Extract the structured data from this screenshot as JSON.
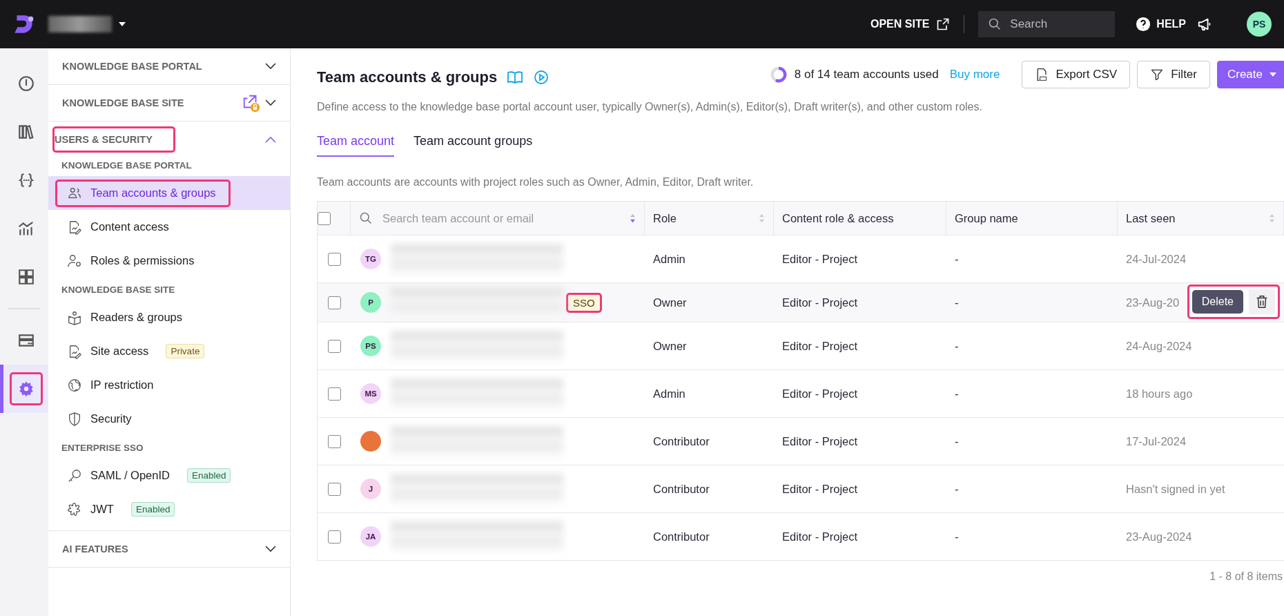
{
  "topbar": {
    "open_site": "OPEN SITE",
    "search": {
      "placeholder": "Search"
    },
    "help": "HELP",
    "user_initials": "PS"
  },
  "rail": [
    {
      "selected": false,
      "highlighted": false
    },
    {
      "selected": false,
      "highlighted": false
    },
    {
      "selected": false,
      "highlighted": false
    },
    {
      "selected": false,
      "highlighted": false
    },
    {
      "selected": false,
      "highlighted": false
    },
    {
      "selected": false,
      "highlighted": false
    },
    {
      "selected": true,
      "highlighted": true
    }
  ],
  "sidebar": [
    {
      "title": "KNOWLEDGE BASE PORTAL",
      "expanded": false,
      "highlighted": false,
      "locked": false
    },
    {
      "title": "KNOWLEDGE BASE SITE",
      "expanded": false,
      "highlighted": false,
      "locked": true
    },
    {
      "title": "USERS & SECURITY",
      "expanded": true,
      "highlighted": true,
      "locked": false,
      "groups": [
        {
          "title": "KNOWLEDGE BASE PORTAL",
          "items": [
            {
              "label": "Team accounts & groups",
              "selected": true,
              "highlighted": true
            },
            {
              "label": "Content access",
              "selected": false,
              "highlighted": false
            },
            {
              "label": "Roles & permissions",
              "selected": false,
              "highlighted": false
            }
          ]
        },
        {
          "title": "KNOWLEDGE BASE SITE",
          "items": [
            {
              "label": "Readers & groups",
              "selected": false,
              "highlighted": false
            },
            {
              "label": "Site access",
              "selected": false,
              "highlighted": false,
              "badge": {
                "text": "Private",
                "kind": "warning"
              }
            },
            {
              "label": "IP restriction",
              "selected": false,
              "highlighted": false
            },
            {
              "label": "Security",
              "selected": false,
              "highlighted": false
            }
          ]
        },
        {
          "title": "ENTERPRISE SSO",
          "items": [
            {
              "label": "SAML / OpenID",
              "selected": false,
              "highlighted": false,
              "badge": {
                "text": "Enabled",
                "kind": "success"
              }
            },
            {
              "label": "JWT",
              "selected": false,
              "highlighted": false,
              "badge": {
                "text": "Enabled",
                "kind": "success"
              }
            }
          ]
        }
      ]
    },
    {
      "title": "AI FEATURES",
      "expanded": false,
      "highlighted": false,
      "locked": false
    }
  ],
  "page": {
    "title": "Team accounts & groups",
    "description": "Define access to the knowledge base portal account user, typically Owner(s), Admin(s), Editor(s), Draft writer(s), and other custom roles.",
    "usage": {
      "text": "8 of 14 team accounts used",
      "level": 0.57
    },
    "buy_more": "Buy more",
    "buttons": [
      {
        "label": "Export CSV",
        "kind": "csv"
      },
      {
        "label": "Filter",
        "kind": "filter"
      },
      {
        "label": "Create",
        "kind": "primary"
      }
    ],
    "tabs": [
      {
        "label": "Team account",
        "selected": true
      },
      {
        "label": "Team account groups",
        "selected": false
      }
    ],
    "note": "Team accounts are accounts with project roles such as Owner, Admin, Editor, Draft writer."
  },
  "table": {
    "select_all_checked": false,
    "search_placeholder": "Search team account or email",
    "columns": [
      {
        "label": "Role",
        "sortable": true
      },
      {
        "label": "Content role & access",
        "sortable": false
      },
      {
        "label": "Group name",
        "sortable": false
      },
      {
        "label": "Last seen",
        "sortable": true
      }
    ],
    "delete_tooltip": "Delete",
    "rows": [
      {
        "checked": false,
        "hovered": false,
        "avatar": {
          "kind": "initials",
          "text": "TG",
          "color": "#f2d4f8"
        },
        "role": "Admin",
        "content": "Editor - Project",
        "group": "-",
        "last_seen": "24-Jul-2024"
      },
      {
        "checked": false,
        "hovered": true,
        "avatar": {
          "kind": "initials",
          "text": "P",
          "color": "#8ff0c2"
        },
        "badge": "SSO",
        "role": "Owner",
        "content": "Editor - Project",
        "group": "-",
        "last_seen": "23-Aug-20"
      },
      {
        "checked": false,
        "hovered": false,
        "avatar": {
          "kind": "initials",
          "text": "PS",
          "color": "#8ff0c2"
        },
        "role": "Owner",
        "content": "Editor - Project",
        "group": "-",
        "last_seen": "24-Aug-2024"
      },
      {
        "checked": false,
        "hovered": false,
        "avatar": {
          "kind": "initials",
          "text": "MS",
          "color": "#f2d4f8"
        },
        "role": "Admin",
        "content": "Editor - Project",
        "group": "-",
        "last_seen": "18 hours ago"
      },
      {
        "checked": false,
        "hovered": false,
        "avatar": {
          "kind": "photo",
          "color": "#e8743a"
        },
        "role": "Contributor",
        "content": "Editor - Project",
        "group": "-",
        "last_seen": "17-Jul-2024"
      },
      {
        "checked": false,
        "hovered": false,
        "avatar": {
          "kind": "initials",
          "text": "J",
          "color": "#f8d3ec"
        },
        "role": "Contributor",
        "content": "Editor - Project",
        "group": "-",
        "last_seen": "Hasn't signed in yet"
      },
      {
        "checked": false,
        "hovered": false,
        "avatar": {
          "kind": "initials",
          "text": "JA",
          "color": "#f2d4f8"
        },
        "role": "Contributor",
        "content": "Editor - Project",
        "group": "-",
        "last_seen": "23-Aug-2024"
      }
    ],
    "pagination": "1 - 8 of 8 items"
  }
}
